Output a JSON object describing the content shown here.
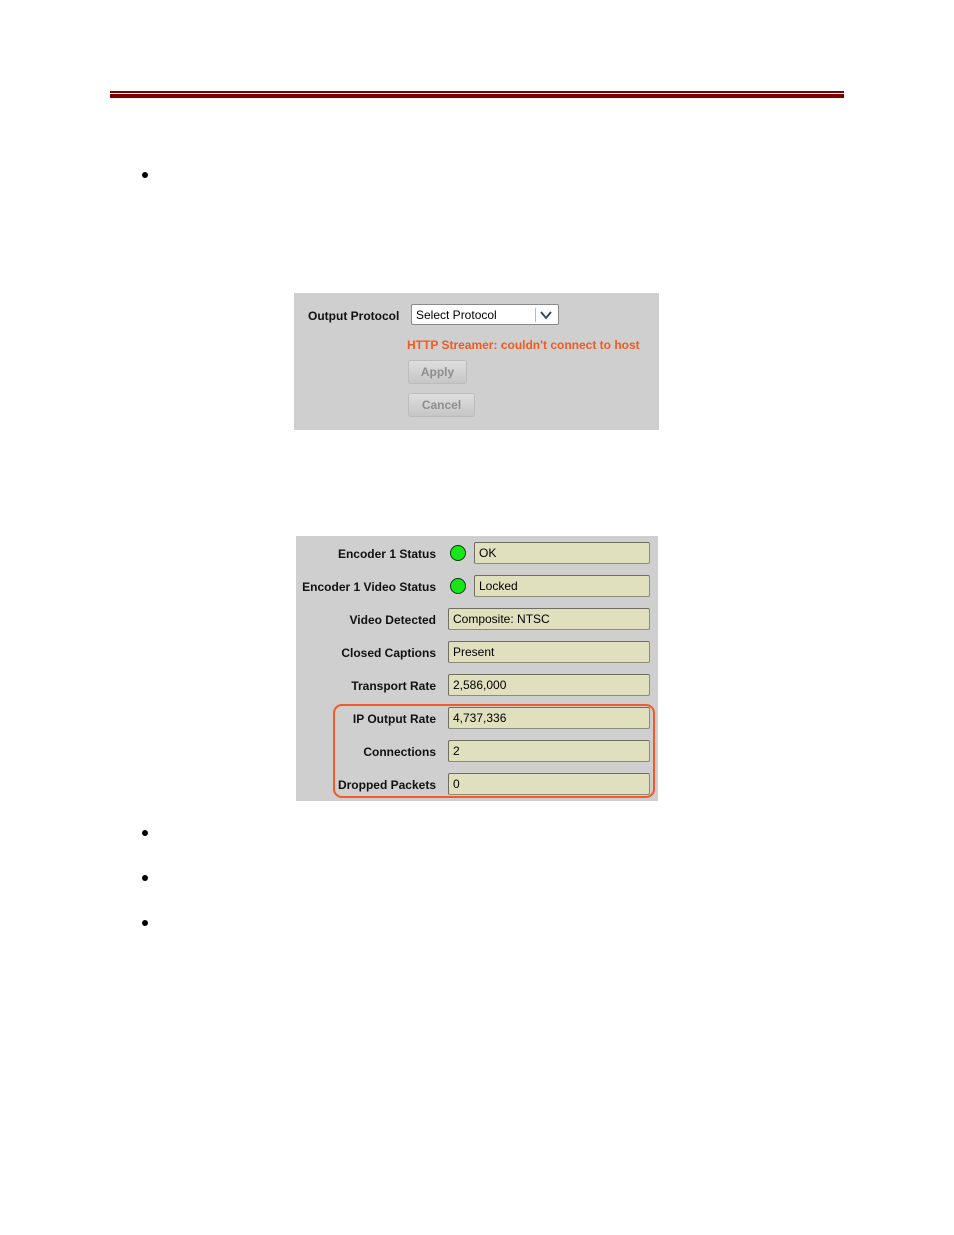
{
  "document": {
    "bullet_count_top": 1,
    "bullet_count_bottom": 3,
    "colors": {
      "header_rule": "#7f0000",
      "error": "#f25a1e",
      "highlight": "#f25a2a",
      "led_ok": "#19e619",
      "field_bg": "#e0dfbe",
      "panel_bg": "#cfcfcf"
    }
  },
  "output_panel": {
    "label": "Output Protocol",
    "select": {
      "value": "Select Protocol",
      "icon": "chevron-down-icon"
    },
    "error_message": "HTTP Streamer: couldn't connect to host",
    "apply_label": "Apply",
    "cancel_label": "Cancel"
  },
  "status_panel": {
    "rows": [
      {
        "label": "Encoder 1 Status",
        "value": "OK",
        "led": "green"
      },
      {
        "label": "Encoder 1 Video Status",
        "value": "Locked",
        "led": "green"
      },
      {
        "label": "Video Detected",
        "value": "Composite: NTSC"
      },
      {
        "label": "Closed Captions",
        "value": "Present"
      },
      {
        "label": "Transport Rate",
        "value": "2,586,000"
      },
      {
        "label": "IP Output Rate",
        "value": "4,737,336"
      },
      {
        "label": "Connections",
        "value": "2"
      },
      {
        "label": "Dropped Packets",
        "value": "0"
      }
    ],
    "highlighted_rows": [
      "IP Output Rate",
      "Connections",
      "Dropped Packets"
    ]
  }
}
